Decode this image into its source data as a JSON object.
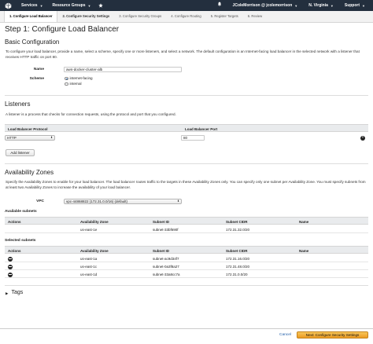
{
  "topnav": {
    "services": "Services",
    "resource_groups": "Resource Groups",
    "account": "JColeMorrison @ jcolemorrison",
    "region": "N. Virginia",
    "support": "Support"
  },
  "wizard_tabs": [
    "1. Configure Load Balancer",
    "2. Configure Security Settings",
    "3. Configure Security Groups",
    "4. Configure Routing",
    "5. Register Targets",
    "6. Review"
  ],
  "step_title": "Step 1: Configure Load Balancer",
  "basic": {
    "title": "Basic Configuration",
    "description": "To configure your load balancer, provide a name, select a scheme, specify one or more listeners, and select a network. The default configuration is an Internet-facing load balancer in the selected network with a listener that receives HTTP traffic on port 80.",
    "name_label": "Name",
    "name_value": "aws-docker-cluster-alb",
    "scheme_label": "Scheme",
    "scheme_options": [
      "internet-facing",
      "internal"
    ],
    "scheme_selected": "internet-facing"
  },
  "listeners": {
    "title": "Listeners",
    "description": "A listener is a process that checks for connection requests, using the protocol and port that you configured.",
    "col_protocol": "Load Balancer Protocol",
    "col_port": "Load Balancer Port",
    "rows": [
      {
        "protocol": "HTTP",
        "port": "80"
      }
    ],
    "add_button": "Add listener"
  },
  "availability": {
    "title": "Availability Zones",
    "description": "Specify the Availability Zones to enable for your load balancer. The load balancer routes traffic to the targets in these Availability Zones only. You can specify only one subnet per Availability Zone. You must specify subnets from at least two Availability Zones to increase the availability of your load balancer.",
    "vpc_label": "VPC",
    "vpc_value": "vpc-44868822 (172.31.0.0/16) (default)",
    "available_title": "Available subnets",
    "selected_title": "Selected subnets",
    "columns": [
      "Actions",
      "Availability Zone",
      "Subnet ID",
      "Subnet CIDR",
      "Name"
    ],
    "available_rows": [
      {
        "zone": "us-east-1e",
        "subnet": "subnet-33bf690f",
        "cidr": "172.31.32.0/20",
        "name": ""
      }
    ],
    "selected_rows": [
      {
        "zone": "us-east-1a",
        "subnet": "subnet-ac9d34f7",
        "cidr": "172.31.16.0/20",
        "name": ""
      },
      {
        "zone": "us-east-1c",
        "subnet": "subnet-0a3f8a27",
        "cidr": "172.31.48.0/20",
        "name": ""
      },
      {
        "zone": "us-east-1d",
        "subnet": "subnet-33a8cc7a",
        "cidr": "172.31.0.0/20",
        "name": ""
      }
    ]
  },
  "tags_title": "Tags",
  "footer": {
    "cancel": "Cancel",
    "next": "Next: Configure Security Settings"
  }
}
